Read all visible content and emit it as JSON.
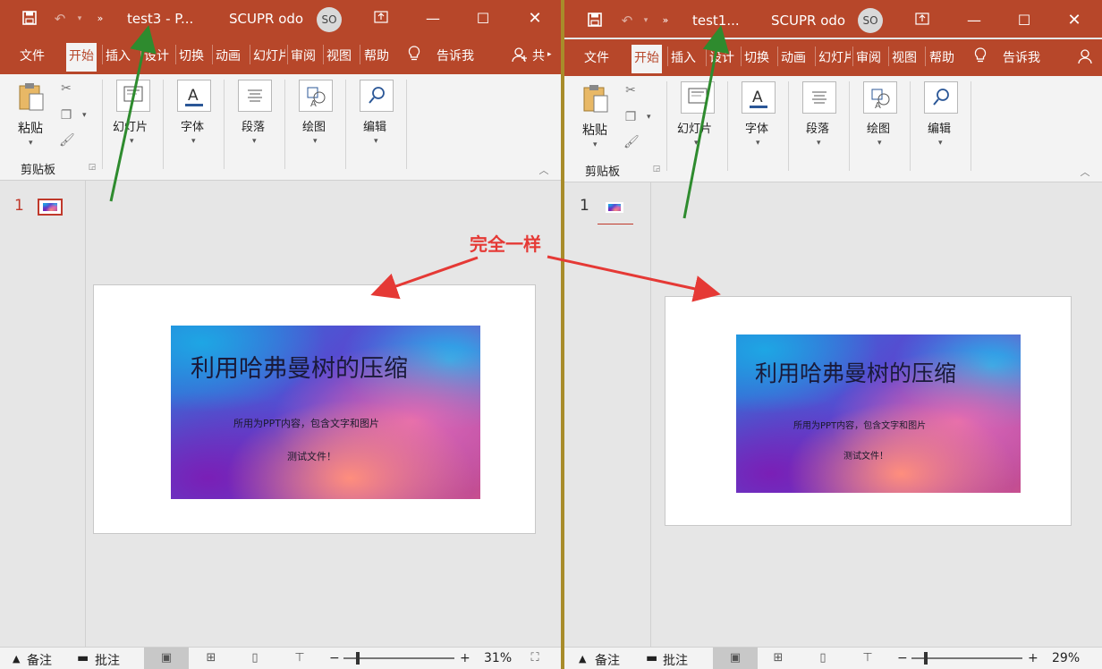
{
  "left": {
    "title": "test3  -  P...",
    "app_user": "SCUPR odo",
    "avatar": "SO",
    "tabs": [
      "文件",
      "开始",
      "插入",
      "设计",
      "切换",
      "动画",
      "幻灯片",
      "审阅",
      "视图",
      "帮助"
    ],
    "active_tab": "开始",
    "tell_me": "告诉我",
    "share": "共",
    "clipboard": {
      "paste": "粘贴",
      "group": "剪贴板"
    },
    "groups": [
      "幻灯片",
      "字体",
      "段落",
      "绘图",
      "编辑"
    ],
    "slide_number": "1",
    "slide": {
      "title": "利用哈弗曼树的压缩",
      "line1": "所用为PPT内容，包含文字和图片",
      "line2": "测试文件！"
    },
    "status": {
      "notes": "备注",
      "comments": "批注",
      "zoom": "31%"
    }
  },
  "right": {
    "title": "test1...",
    "app_user": "SCUPR odo",
    "avatar": "SO",
    "tabs": [
      "文件",
      "开始",
      "插入",
      "设计",
      "切换",
      "动画",
      "幻灯片",
      "审阅",
      "视图",
      "帮助"
    ],
    "active_tab": "开始",
    "tell_me": "告诉我",
    "clipboard": {
      "paste": "粘贴",
      "group": "剪贴板"
    },
    "groups": [
      "幻灯片",
      "字体",
      "段落",
      "绘图",
      "编辑"
    ],
    "slide_number": "1",
    "slide": {
      "title": "利用哈弗曼树的压缩",
      "line1": "所用为PPT内容，包含文字和图片",
      "line2": "测试文件！"
    },
    "status": {
      "notes": "备注",
      "comments": "批注",
      "zoom": "29%"
    }
  },
  "annotation": {
    "text": "完全一样",
    "color": "#e53935",
    "arrow_color_green": "#2e8b2e"
  },
  "colors": {
    "accent": "#b7472a",
    "ribbon": "#f3f3f3",
    "pane": "#e6e6e6"
  }
}
